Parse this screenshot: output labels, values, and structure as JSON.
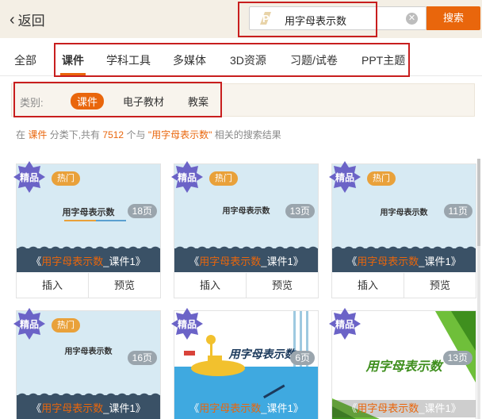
{
  "header": {
    "back_label": "返回",
    "search_value": "用字母表示数",
    "search_button": "搜索"
  },
  "tabs": [
    "全部",
    "课件",
    "学科工具",
    "多媒体",
    "3D资源",
    "习题/试卷",
    "PPT主题"
  ],
  "category": {
    "label": "类别:",
    "items": [
      "课件",
      "电子教材",
      "教案"
    ]
  },
  "summary": {
    "prefix": "在",
    "cat": "课件",
    "mid1": "分类下,共有",
    "count": "7512",
    "mid2": "个与",
    "keyword": "\"用字母表示数\"",
    "suffix": "相关的搜索结果"
  },
  "cards": [
    {
      "badge": "精品",
      "hot": "热门",
      "thumb_title": "用字母表示数",
      "pages": "18页",
      "cap_pre": "《",
      "cap_kw": "用字母表示数",
      "cap_post": "_课件1》",
      "insert": "插入",
      "preview": "预览"
    },
    {
      "badge": "精品",
      "hot": "热门",
      "thumb_title": "用字母表示数",
      "pages": "13页",
      "cap_pre": "《",
      "cap_kw": "用字母表示数",
      "cap_post": "_课件1》",
      "insert": "插入",
      "preview": "预览"
    },
    {
      "badge": "精品",
      "hot": "热门",
      "thumb_title": "用字母表示数",
      "pages": "11页",
      "cap_pre": "《",
      "cap_kw": "用字母表示数",
      "cap_post": "_课件1》",
      "insert": "插入",
      "preview": "预览"
    },
    {
      "badge": "精品",
      "hot": "热门",
      "thumb_title": "用字母表示数",
      "pages": "16页",
      "cap_pre": "《",
      "cap_kw": "用字母表示数",
      "cap_post": "_课件1》"
    },
    {
      "badge": "精品",
      "thumb_title": "用字母表示数",
      "pages": "6页",
      "cap_pre": "《",
      "cap_kw": "用字母表示数",
      "cap_post": "_课件1》"
    },
    {
      "badge": "精品",
      "thumb_title": "用字母表示数",
      "pages": "13页",
      "cap_pre": "《",
      "cap_kw": "用字母表示数",
      "cap_post": "_课件1》"
    }
  ],
  "colors": {
    "accent": "#e9660c",
    "highlight": "#c81e1e",
    "header_bg": "#f4efe5"
  }
}
